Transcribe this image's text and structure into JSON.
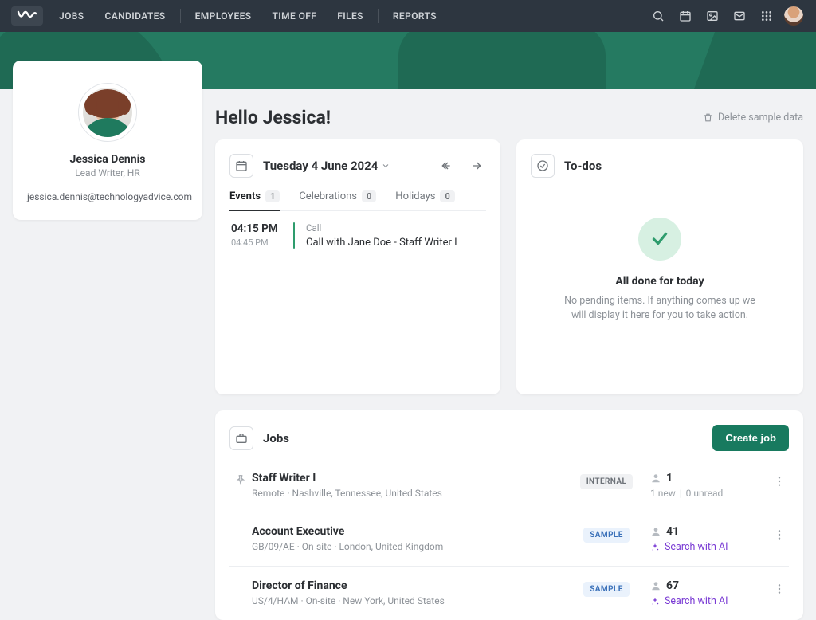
{
  "nav": {
    "items": [
      "JOBS",
      "CANDIDATES",
      "EMPLOYEES",
      "TIME OFF",
      "FILES",
      "REPORTS"
    ]
  },
  "user": {
    "name": "Jessica Dennis",
    "role": "Lead Writer, HR",
    "email": "jessica.dennis@technologyadvice.com"
  },
  "greeting": "Hello Jessica!",
  "delete_sample": "Delete sample data",
  "agenda": {
    "date_label": "Tuesday 4 June 2024",
    "tabs": [
      {
        "label": "Events",
        "count": "1"
      },
      {
        "label": "Celebrations",
        "count": "0"
      },
      {
        "label": "Holidays",
        "count": "0"
      }
    ],
    "event": {
      "start": "04:15 PM",
      "end": "04:45 PM",
      "kind": "Call",
      "title": "Call with Jane Doe - Staff Writer I"
    }
  },
  "todos": {
    "heading": "To-dos",
    "done_title": "All done for today",
    "done_sub": "No pending items. If anything comes up we will display it here for you to take action."
  },
  "jobs": {
    "heading": "Jobs",
    "create_label": "Create job",
    "search_ai": "Search with AI",
    "rows": [
      {
        "title": "Staff Writer I",
        "meta": "Remote · Nashville, Tennessee, United States",
        "tag": "INTERNAL",
        "count": "1",
        "sub_a": "1 new",
        "sub_b": "0 unread",
        "pinned": true,
        "tag_class": "internal",
        "ai": false
      },
      {
        "title": "Account Executive",
        "meta": "GB/09/AE · On-site · London, United Kingdom",
        "tag": "SAMPLE",
        "count": "41",
        "tag_class": "sample",
        "ai": true
      },
      {
        "title": "Director of Finance",
        "meta": "US/4/HAM · On-site · New York, United States",
        "tag": "SAMPLE",
        "count": "67",
        "tag_class": "sample",
        "ai": true
      }
    ]
  }
}
